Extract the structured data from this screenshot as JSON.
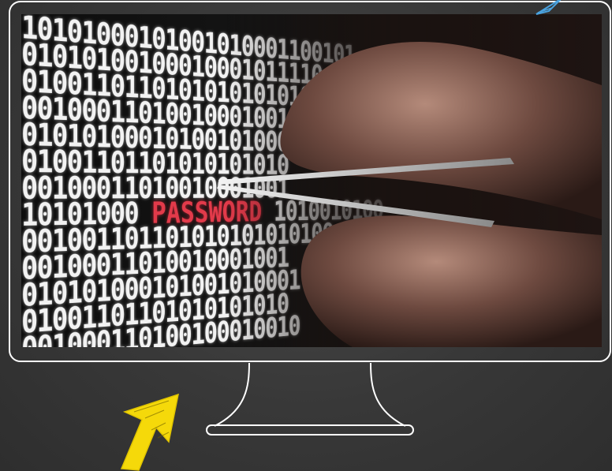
{
  "photo": {
    "caption_word": "PASSWORD",
    "binary_rows": [
      "10101000101001010001100101",
      "01010100100010001011110",
      "0100110110101010101010",
      "00100011010010001001",
      "010101000101001010001",
      "01001101101010101010",
      "00100011010010001001",
      "10101000 ",
      "001001101101010101010100",
      "00100011010010001001",
      "010101000101001010001",
      "01001101101010101010",
      "001000110100100010010"
    ],
    "password_row_suffix": " 1010010100"
  },
  "colors": {
    "background": "#3a3a3a",
    "monitor_outline": "#ffffff",
    "password_text": "#e23a4a",
    "arrow_fill": "#f5d90a",
    "corner_arrow": "#4aa3e0"
  },
  "icons": {
    "pointer": "hand-drawn-arrow-icon",
    "corner": "paper-plane-icon"
  }
}
